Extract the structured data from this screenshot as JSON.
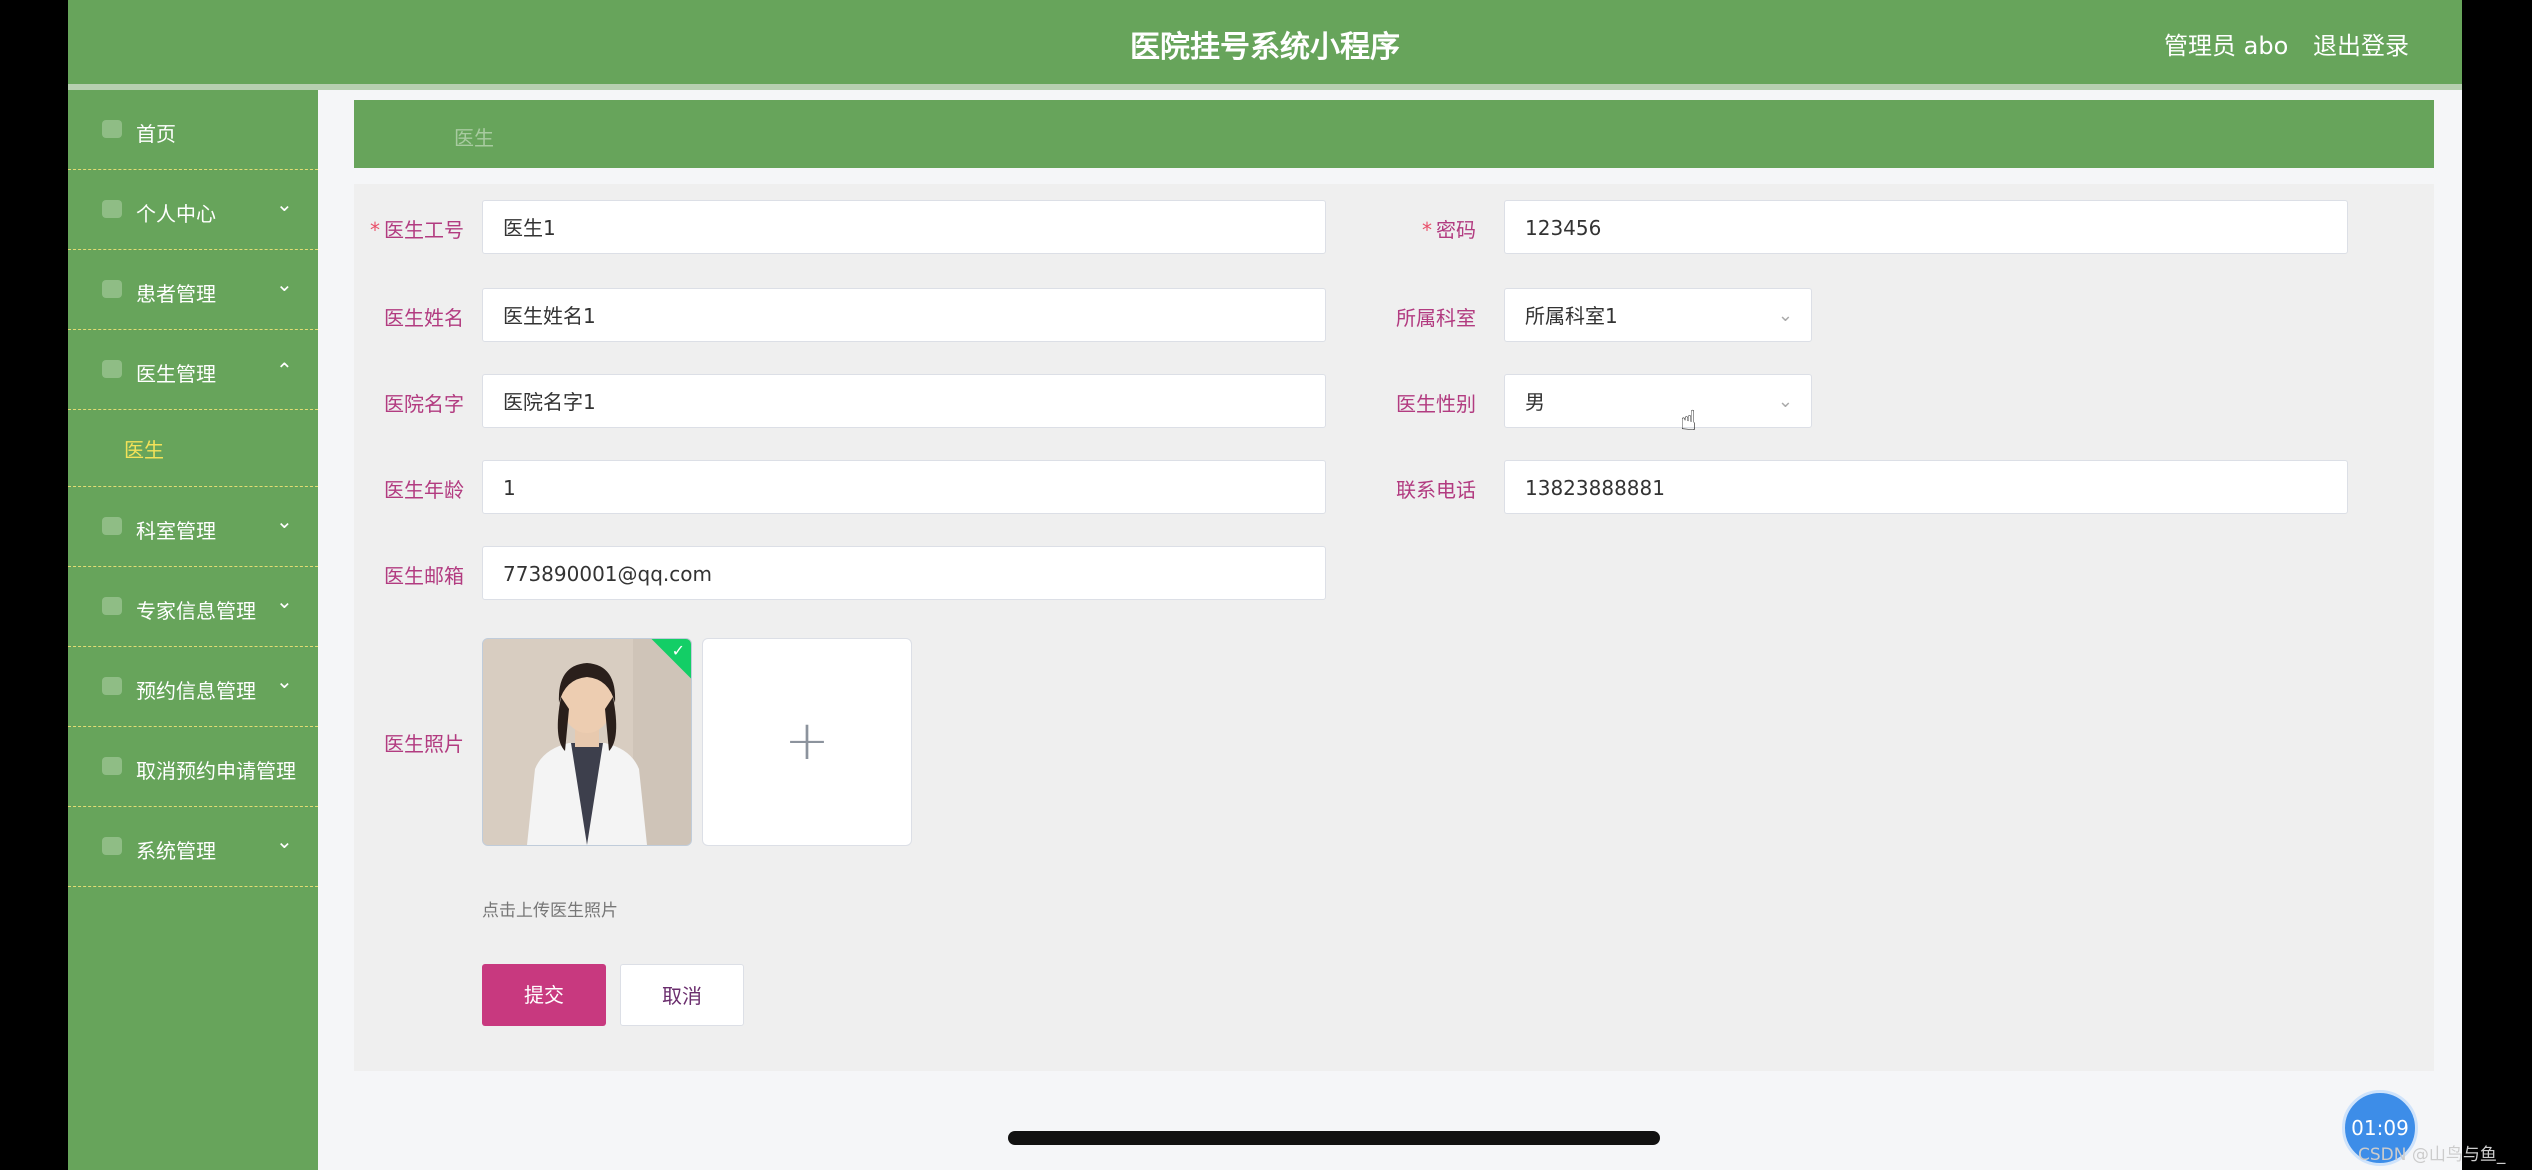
{
  "header": {
    "title": "医院挂号系统小程序",
    "admin": "管理员 abo",
    "logout": "退出登录"
  },
  "sidebar": {
    "items": [
      {
        "label": "首页",
        "icon": "home-icon"
      },
      {
        "label": "个人中心",
        "icon": "user-icon"
      },
      {
        "label": "患者管理",
        "icon": "patient-icon"
      },
      {
        "label": "医生管理",
        "icon": "doctor-icon"
      },
      {
        "label": "医生"
      },
      {
        "label": "科室管理",
        "icon": "department-icon"
      },
      {
        "label": "专家信息管理",
        "icon": "expert-icon"
      },
      {
        "label": "预约信息管理",
        "icon": "appointment-icon"
      },
      {
        "label": "取消预约申请管理",
        "icon": "cancel-icon"
      },
      {
        "label": "系统管理",
        "icon": "settings-icon"
      }
    ]
  },
  "breadcrumb": "医生",
  "form": {
    "doctor_id": {
      "label": "医生工号",
      "value": "医生1"
    },
    "password": {
      "label": "密码",
      "value": "123456"
    },
    "name": {
      "label": "医生姓名",
      "value": "医生姓名1"
    },
    "department": {
      "label": "所属科室",
      "value": "所属科室1"
    },
    "hospital": {
      "label": "医院名字",
      "value": "医院名字1"
    },
    "gender": {
      "label": "医生性别",
      "value": "男"
    },
    "age": {
      "label": "医生年龄",
      "value": "1"
    },
    "phone": {
      "label": "联系电话",
      "value": "13823888881"
    },
    "email": {
      "label": "医生邮箱",
      "value": "773890001@qq.com"
    },
    "photo": {
      "label": "医生照片",
      "hint": "点击上传医生照片"
    },
    "submit": "提交",
    "cancel": "取消"
  },
  "overlay": {
    "timer": "01:09",
    "watermark": "CSDN @山鸟与鱼_"
  },
  "colors": {
    "primary_green": "#67a45b",
    "accent_pink": "#c8397f",
    "label_magenta": "#b23b80"
  }
}
